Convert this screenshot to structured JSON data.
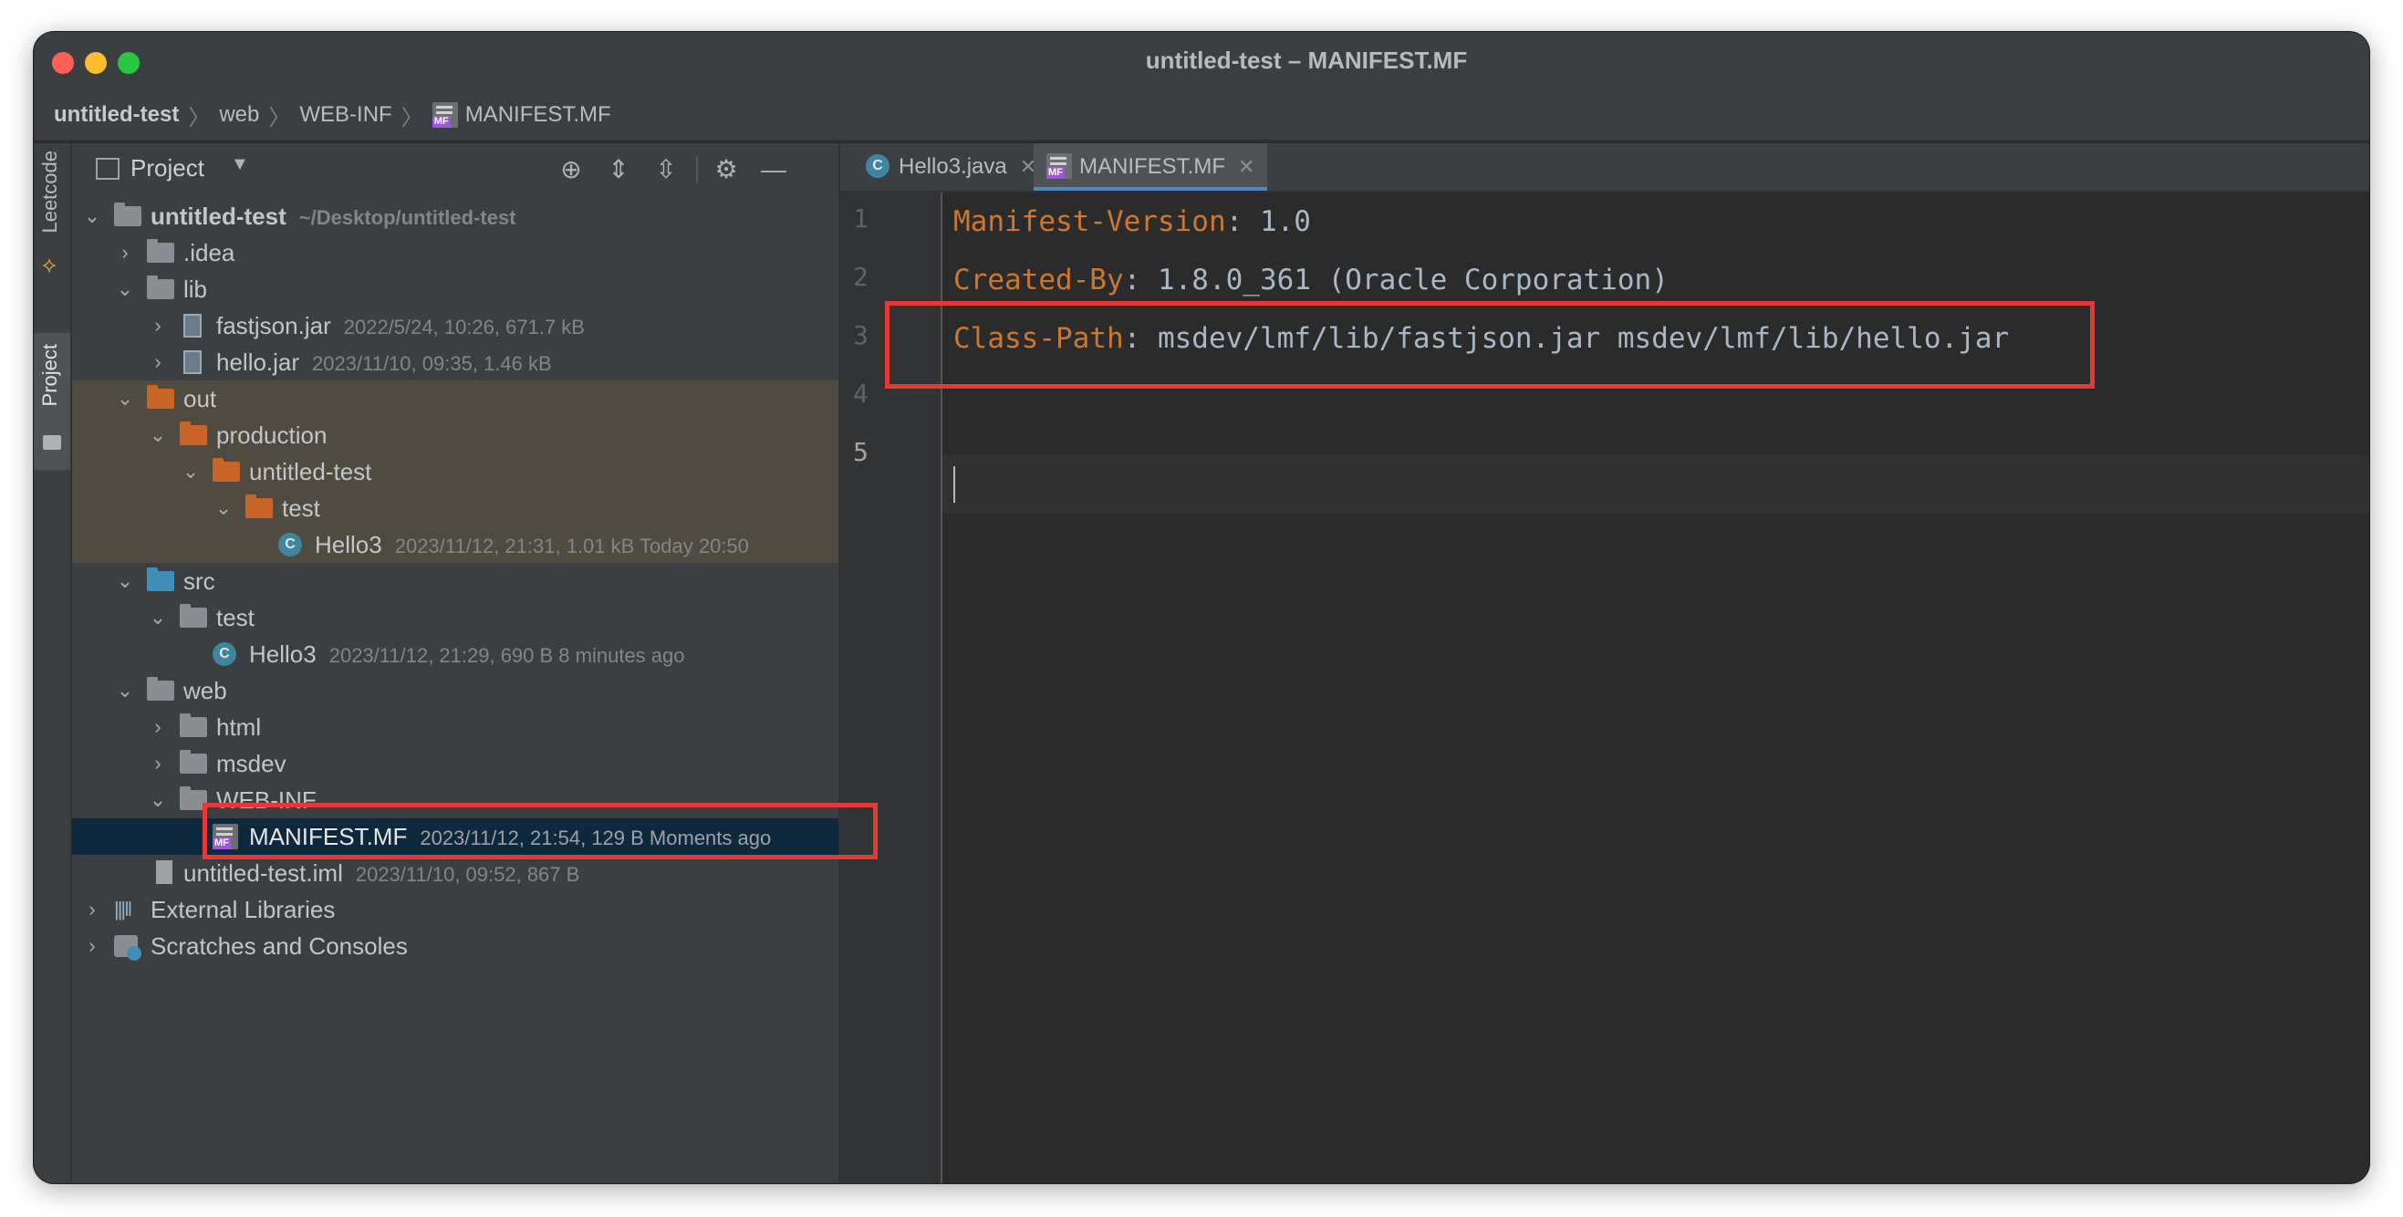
{
  "window": {
    "title": "untitled-test – MANIFEST.MF",
    "traffic_lights": {
      "close": "#ff5f57",
      "minimize": "#febc2e",
      "maximize": "#28c840"
    }
  },
  "breadcrumb": {
    "items": [
      "untitled-test",
      "web",
      "WEB-INF",
      "MANIFEST.MF"
    ],
    "separator": "〉"
  },
  "tool_strip": {
    "leetcode_label": "Leetcode",
    "project_label": "Project"
  },
  "project_panel": {
    "title": "Project",
    "tree": [
      {
        "name": "untitled-test",
        "meta": "~/Desktop/untitled-test"
      },
      {
        "name": ".idea",
        "meta": ""
      },
      {
        "name": "lib",
        "meta": ""
      },
      {
        "name": "fastjson.jar",
        "meta": "2022/5/24, 10:26, 671.7 kB"
      },
      {
        "name": "hello.jar",
        "meta": "2023/11/10, 09:35, 1.46 kB"
      },
      {
        "name": "out",
        "meta": ""
      },
      {
        "name": "production",
        "meta": ""
      },
      {
        "name": "untitled-test",
        "meta": ""
      },
      {
        "name": "test",
        "meta": ""
      },
      {
        "name": "Hello3",
        "meta": "2023/11/12, 21:31, 1.01 kB Today 20:50"
      },
      {
        "name": "src",
        "meta": ""
      },
      {
        "name": "test",
        "meta": ""
      },
      {
        "name": "Hello3",
        "meta": "2023/11/12, 21:29, 690 B 8 minutes ago"
      },
      {
        "name": "web",
        "meta": ""
      },
      {
        "name": "html",
        "meta": ""
      },
      {
        "name": "msdev",
        "meta": ""
      },
      {
        "name": "WEB-INF",
        "meta": ""
      },
      {
        "name": "MANIFEST.MF",
        "meta": "2023/11/12, 21:54, 129 B Moments ago"
      },
      {
        "name": "untitled-test.iml",
        "meta": "2023/11/10, 09:52, 867 B"
      },
      {
        "name": "External Libraries",
        "meta": ""
      },
      {
        "name": "Scratches and Consoles",
        "meta": ""
      }
    ]
  },
  "editor": {
    "tabs": [
      {
        "label": "Hello3.java",
        "active": false
      },
      {
        "label": "MANIFEST.MF",
        "active": true
      }
    ],
    "line_numbers": [
      "1",
      "2",
      "3",
      "4",
      "5"
    ],
    "lines": [
      {
        "key": "Manifest-Version",
        "value": ": 1.0"
      },
      {
        "key": "Created-By",
        "value": ": 1.8.0_361 (Oracle Corporation)"
      },
      {
        "key": "Class-Path",
        "value": ": msdev/lmf/lib/fastjson.jar msdev/lmf/lib/hello.jar"
      },
      {
        "key": "",
        "value": ""
      },
      {
        "key": "",
        "value": ""
      }
    ]
  },
  "colors": {
    "highlight_box": "#e53935",
    "manifest_key": "#cc7832",
    "out_folder": "#c86427",
    "source_folder": "#3d8eb8",
    "selected_row": "#0d293e"
  }
}
